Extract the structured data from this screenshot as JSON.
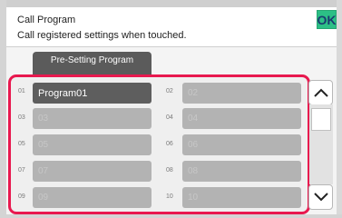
{
  "header": {
    "title": "Call Program",
    "subtitle": "Call registered settings when touched.",
    "ok_label": "OK"
  },
  "preset_button": {
    "label": "Pre-Setting Program"
  },
  "programs": [
    {
      "num": "01",
      "name": "Program01"
    },
    {
      "num": "02",
      "name": "02"
    },
    {
      "num": "03",
      "name": "03"
    },
    {
      "num": "04",
      "name": "04"
    },
    {
      "num": "05",
      "name": "05"
    },
    {
      "num": "06",
      "name": "06"
    },
    {
      "num": "07",
      "name": "07"
    },
    {
      "num": "08",
      "name": "08"
    },
    {
      "num": "09",
      "name": "09"
    },
    {
      "num": "10",
      "name": "10"
    }
  ],
  "scroll": {
    "up_icon": "chevron-up-icon",
    "down_icon": "chevron-down-icon"
  },
  "colors": {
    "ok": "#2cbf86",
    "highlight": "#e8194f",
    "selected_slot": "#5e5e5e",
    "empty_slot": "#b3b3b3"
  }
}
